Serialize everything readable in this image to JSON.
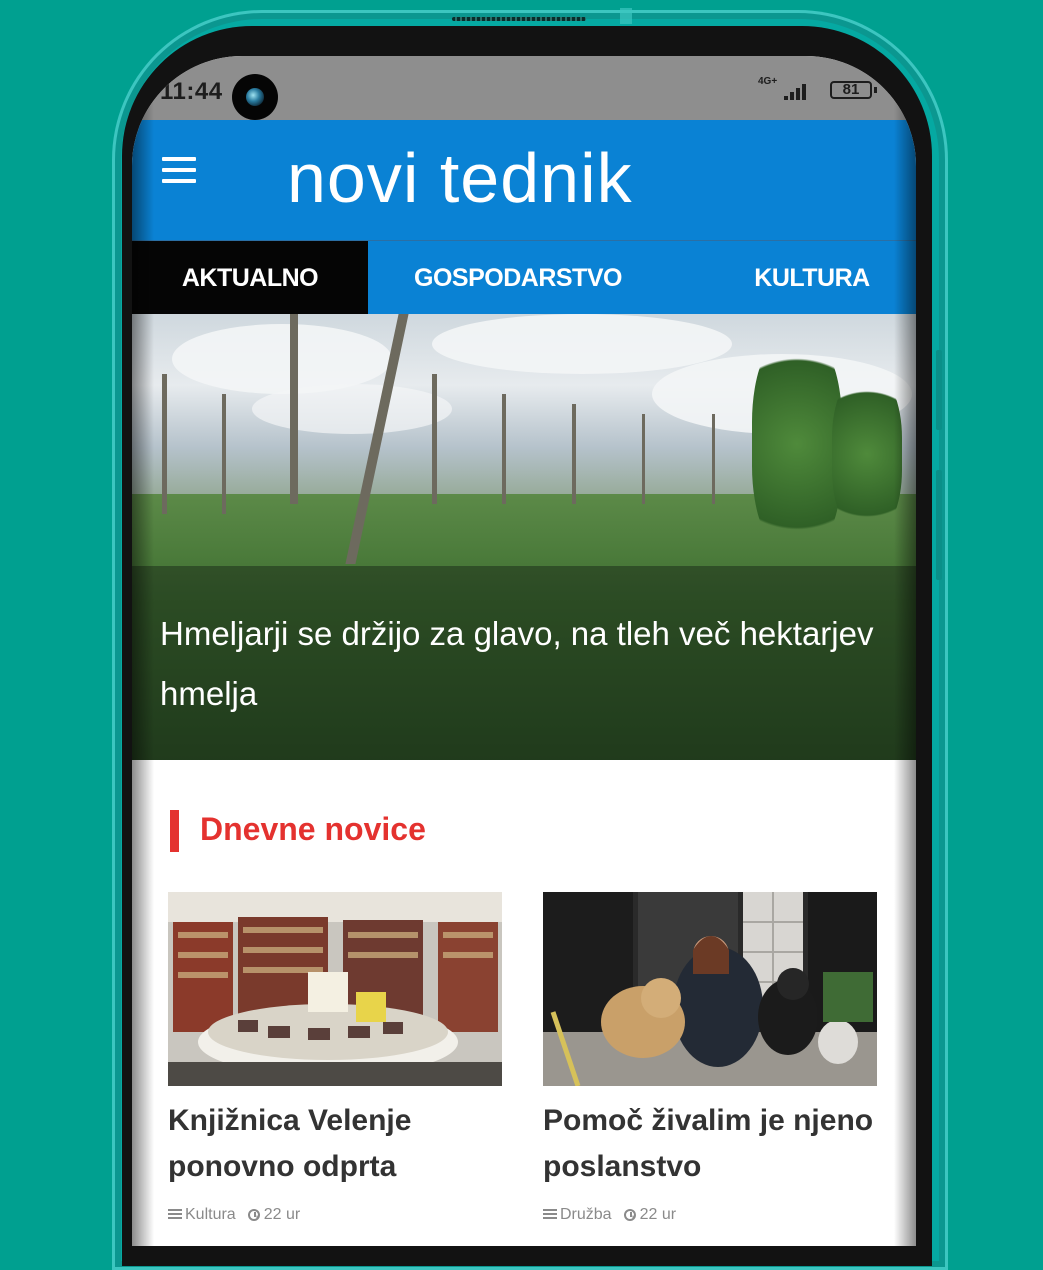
{
  "status_bar": {
    "time": "11:44",
    "network": "4G+",
    "battery": "81"
  },
  "app": {
    "logo": "novi tednik",
    "menu_icon": "hamburger-menu-icon"
  },
  "tabs": [
    {
      "label": "AKTUALNO",
      "active": true
    },
    {
      "label": "GOSPODARSTVO",
      "active": false
    },
    {
      "label": "KULTURA",
      "active": false
    }
  ],
  "hero": {
    "title": "Hmeljarji se držijo za glavo, na tleh več hektarjev hmelja",
    "image": "hop-field-photo"
  },
  "section": {
    "title": "Dnevne novice"
  },
  "articles": [
    {
      "title": "Knjižnica Velenje ponovno odprta",
      "category": "Kultura",
      "time": "22 ur",
      "image": "library-bookshelves-photo"
    },
    {
      "title": "Pomoč živalim je njeno poslanstvo",
      "category": "Družba",
      "time": "22 ur",
      "image": "woman-with-dogs-photo"
    }
  ],
  "colors": {
    "background": "#00a090",
    "brand_blue": "#0a82d4",
    "accent_red": "#e4322f",
    "active_tab": "#050505"
  }
}
